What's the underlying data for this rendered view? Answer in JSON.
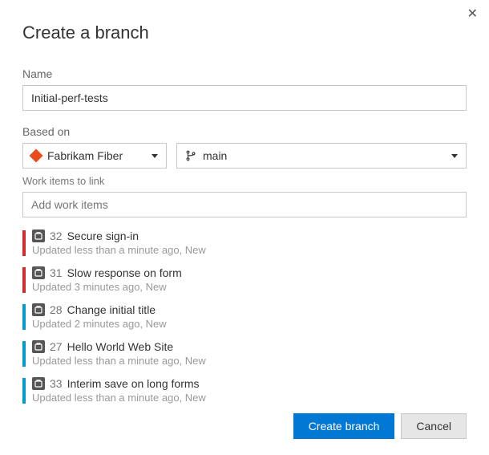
{
  "dialog": {
    "title": "Create a branch",
    "close_glyph": "✕"
  },
  "name": {
    "label": "Name",
    "value": "Initial-perf-tests"
  },
  "basedOn": {
    "label": "Based on",
    "repo": "Fabrikam Fiber",
    "branch": "main"
  },
  "workItems": {
    "label": "Work items to link",
    "placeholder": "Add work items",
    "items": [
      {
        "color": "red",
        "id": "32",
        "title": "Secure sign-in",
        "sub": "Updated less than a minute ago, New"
      },
      {
        "color": "red",
        "id": "31",
        "title": "Slow response on form",
        "sub": "Updated 3 minutes ago, New"
      },
      {
        "color": "blue",
        "id": "28",
        "title": "Change initial title",
        "sub": "Updated 2 minutes ago, New"
      },
      {
        "color": "blue",
        "id": "27",
        "title": "Hello World Web Site",
        "sub": "Updated less than a minute ago, New"
      },
      {
        "color": "blue",
        "id": "33",
        "title": "Interim save on long forms",
        "sub": "Updated less than a minute ago, New"
      }
    ]
  },
  "footer": {
    "primary": "Create branch",
    "secondary": "Cancel"
  }
}
